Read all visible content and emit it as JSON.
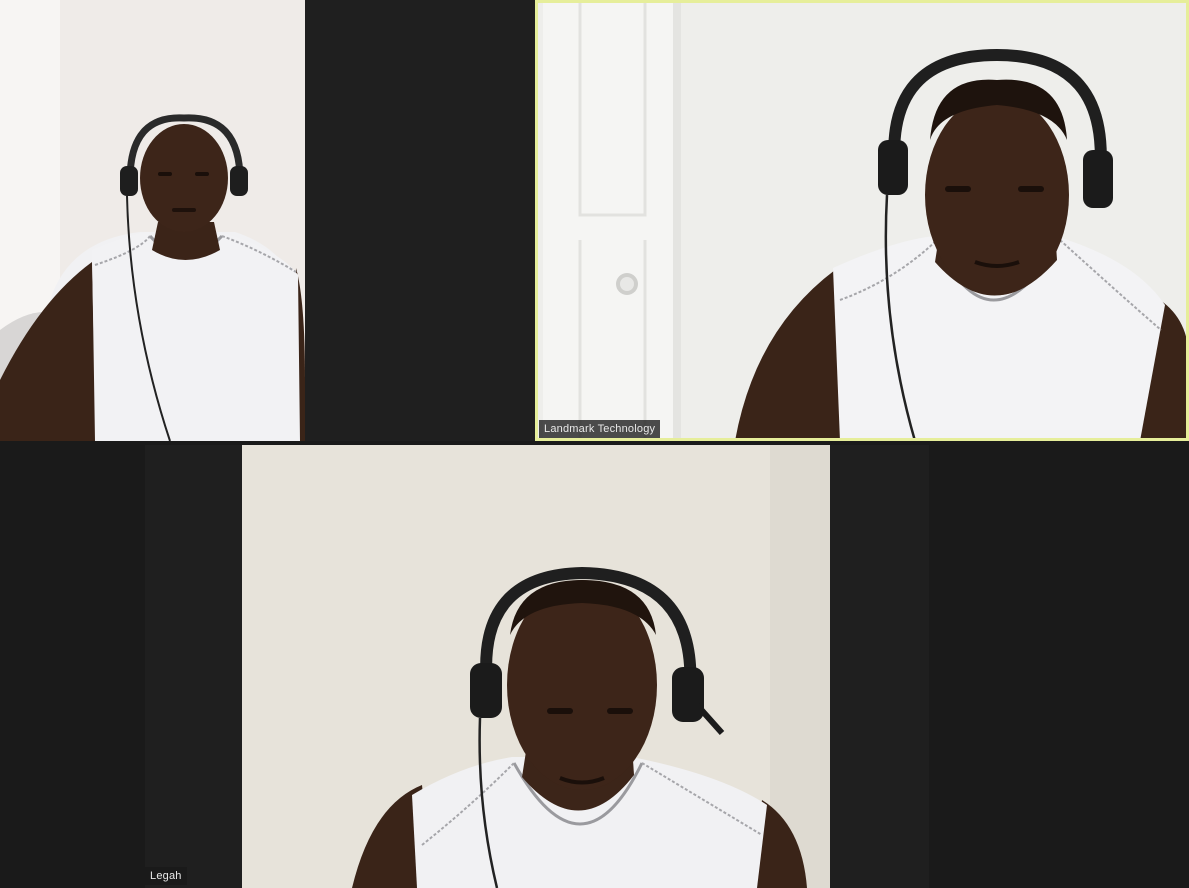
{
  "participants": [
    {
      "id": "tile-a",
      "name": "",
      "active_speaker": false
    },
    {
      "id": "tile-b",
      "name": "Landmark Technology",
      "active_speaker": true
    },
    {
      "id": "tile-c",
      "name": "Legah",
      "active_speaker": false
    }
  ],
  "colors": {
    "background": "#1a1a1a",
    "active_speaker_border": "#e6ee9a",
    "name_tag_bg": "#1a1a1a",
    "name_tag_text": "#e8e8e8"
  }
}
